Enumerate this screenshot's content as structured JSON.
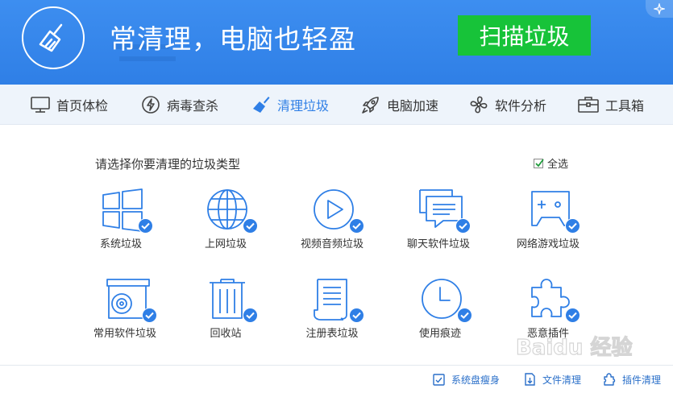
{
  "header": {
    "slogan": "常清理，电脑也轻盈",
    "scan_button": "扫描垃圾"
  },
  "nav": [
    {
      "label": "首页体检",
      "icon": "monitor-icon"
    },
    {
      "label": "病毒查杀",
      "icon": "lightning-icon"
    },
    {
      "label": "清理垃圾",
      "icon": "broom-icon",
      "active": true
    },
    {
      "label": "电脑加速",
      "icon": "rocket-icon"
    },
    {
      "label": "软件分析",
      "icon": "fan-icon"
    },
    {
      "label": "工具箱",
      "icon": "toolbox-icon"
    }
  ],
  "main": {
    "title": "请选择你要清理的垃圾类型",
    "select_all": "全选",
    "categories": [
      {
        "label": "系统垃圾",
        "icon": "windows-icon",
        "checked": true
      },
      {
        "label": "上网垃圾",
        "icon": "globe-icon",
        "checked": true
      },
      {
        "label": "视频音频垃圾",
        "icon": "play-icon",
        "checked": true
      },
      {
        "label": "聊天软件垃圾",
        "icon": "chat-icon",
        "checked": true
      },
      {
        "label": "网络游戏垃圾",
        "icon": "gamepad-icon",
        "checked": true
      },
      {
        "label": "常用软件垃圾",
        "icon": "disc-box-icon",
        "checked": true
      },
      {
        "label": "回收站",
        "icon": "trash-icon",
        "checked": true
      },
      {
        "label": "注册表垃圾",
        "icon": "document-icon",
        "checked": true
      },
      {
        "label": "使用痕迹",
        "icon": "clock-icon",
        "checked": true
      },
      {
        "label": "恶意插件",
        "icon": "puzzle-icon",
        "checked": true
      }
    ]
  },
  "footer": {
    "tools": [
      {
        "label": "系统盘瘦身",
        "icon": "disk-slim-icon"
      },
      {
        "label": "文件清理",
        "icon": "file-clean-icon"
      },
      {
        "label": "插件清理",
        "icon": "plugin-clean-icon"
      }
    ]
  },
  "watermark": "Baidu 经验",
  "colors": {
    "header_blue": "#2f7fe6",
    "scan_green": "#17c339",
    "icon_blue": "#2f7fe6"
  }
}
